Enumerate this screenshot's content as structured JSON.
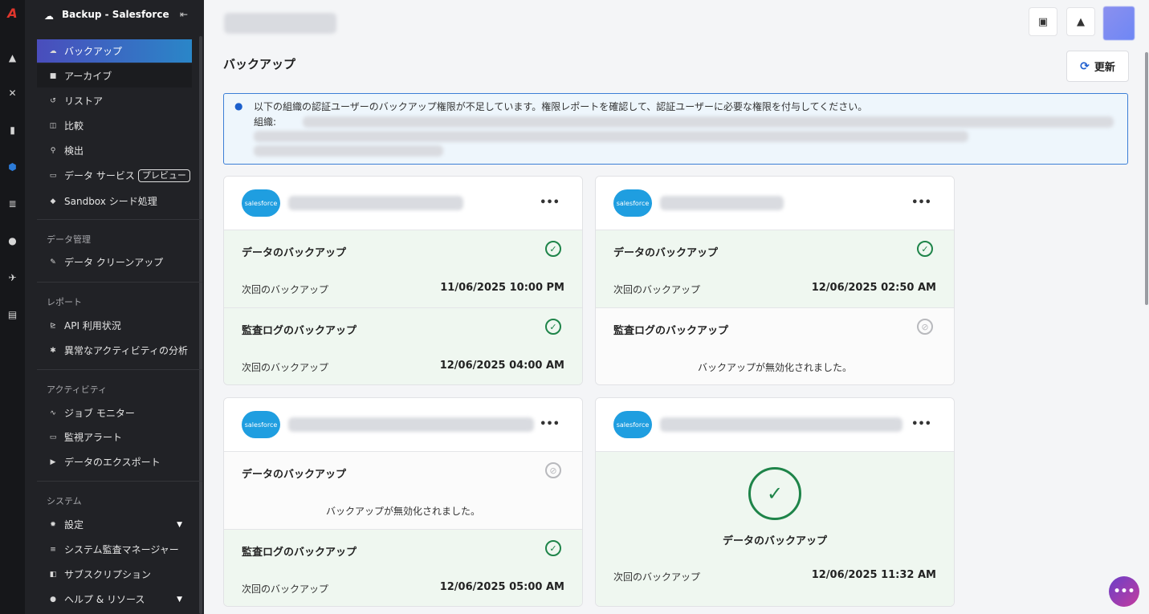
{
  "rail": {
    "logo": "A",
    "icons": [
      "▲",
      "✕",
      "▮",
      "⬢",
      "≣",
      "●",
      "✈",
      "▤"
    ]
  },
  "sidebar": {
    "title": "Backup - Salesforce",
    "cloud_icon": "☁",
    "collapse_icon": "⇤",
    "items": [
      {
        "label": "バックアップ",
        "icon": "☁"
      },
      {
        "label": "アーカイブ",
        "icon": "■"
      },
      {
        "label": "リストア",
        "icon": "↺"
      },
      {
        "label": "比較",
        "icon": "◫"
      },
      {
        "label": "検出",
        "icon": "⚲"
      },
      {
        "label": "データ サービス",
        "icon": "▭",
        "badge": "プレビュー"
      },
      {
        "label": "Sandbox シード処理",
        "icon": "◆"
      }
    ],
    "sections": {
      "data_mgmt": {
        "label": "データ管理",
        "items": [
          {
            "label": "データ クリーンアップ",
            "icon": "✎"
          }
        ]
      },
      "reports": {
        "label": "レポート",
        "items": [
          {
            "label": "API 利用状況",
            "icon": "⊵"
          },
          {
            "label": "異常なアクティビティの分析",
            "icon": "✱"
          }
        ]
      },
      "activity": {
        "label": "アクティビティ",
        "items": [
          {
            "label": "ジョブ モニター",
            "icon": "∿"
          },
          {
            "label": "監視アラート",
            "icon": "▭"
          },
          {
            "label": "データのエクスポート",
            "icon": "▶"
          }
        ]
      },
      "system": {
        "label": "システム",
        "items": [
          {
            "label": "設定",
            "icon": "✹"
          },
          {
            "label": "システム監査マネージャー",
            "icon": "≡"
          },
          {
            "label": "サブスクリプション",
            "icon": "◧"
          },
          {
            "label": "ヘルプ & リソース",
            "icon": "●"
          }
        ]
      }
    }
  },
  "header": {
    "calendar_icon": "▣",
    "bell_icon": "▲"
  },
  "main": {
    "page_title": "バックアップ",
    "refresh_label": "更新",
    "refresh_icon": "⟳",
    "alert": {
      "icon": "●",
      "text": "以下の組織の認証ユーザーのバックアップ権限が不足しています。権限レポートを確認して、認証ユーザーに必要な権限を付与してください。",
      "org_label": "組織:"
    },
    "salesforce_logo": "salesforce",
    "more_icon": "•••",
    "check_icon": "✓",
    "off_icon": "⊘",
    "cards": [
      {
        "sections": [
          {
            "title": "データのバックアップ",
            "label": "次回のバックアップ",
            "time": "11/06/2025 10:00 PM"
          },
          {
            "title": "監査ログのバックアップ",
            "label": "次回のバックアップ",
            "time": "12/06/2025 04:00 AM"
          }
        ]
      },
      {
        "sections": [
          {
            "title": "データのバックアップ",
            "label": "次回のバックアップ",
            "time": "12/06/2025 02:50 AM"
          },
          {
            "title": "監査ログのバックアップ",
            "disabled": "バックアップが無効化されました。"
          }
        ]
      },
      {
        "sections": [
          {
            "title": "データのバックアップ",
            "disabled": "バックアップが無効化されました。"
          },
          {
            "title": "監査ログのバックアップ",
            "label": "次回のバックアップ",
            "time": "12/06/2025 05:00 AM"
          }
        ]
      },
      {
        "big": {
          "title": "データのバックアップ",
          "label": "次回のバックアップ",
          "time": "12/06/2025 11:32 AM"
        }
      }
    ]
  },
  "chat_icon": "•••"
}
